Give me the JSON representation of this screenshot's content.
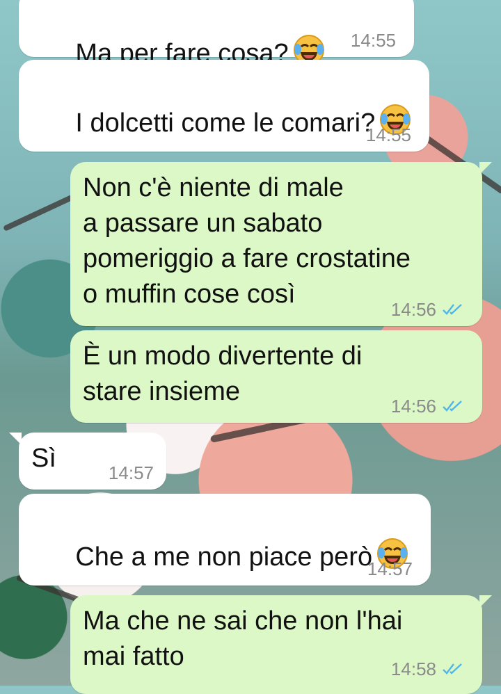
{
  "colors": {
    "incoming_bubble": "#ffffff",
    "outgoing_bubble": "#dcf8c6",
    "timestamp": "#8a8a8a",
    "read_ticks": "#4fb6ec"
  },
  "messages": [
    {
      "direction": "incoming",
      "text": "Ma per fare cosa?",
      "emoji": "face-with-tears-of-joy",
      "time": "14:55"
    },
    {
      "direction": "incoming",
      "text": "I dolcetti come le comari?",
      "emoji": "face-with-tears-of-joy",
      "time": "14:55"
    },
    {
      "direction": "outgoing",
      "text": "Non c'è niente di male\na passare un sabato\npomeriggio a fare crostatine\no muffin cose così",
      "time": "14:56",
      "status_icon": "double-check-read-icon"
    },
    {
      "direction": "outgoing",
      "text": "È un modo divertente di\nstare insieme",
      "time": "14:56",
      "status_icon": "double-check-read-icon"
    },
    {
      "direction": "incoming",
      "text": "Sì",
      "time": "14:57"
    },
    {
      "direction": "incoming",
      "text": "Che a me non piace però",
      "emoji": "face-with-tears-of-joy",
      "time": "14:57"
    },
    {
      "direction": "outgoing",
      "text": "Ma che ne sai che non l'hai\nmai fatto",
      "time": "14:58",
      "status_icon": "double-check-read-icon"
    }
  ]
}
